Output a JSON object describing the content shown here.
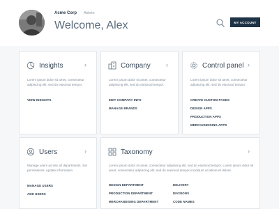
{
  "header": {
    "company": "Acme Corp",
    "role": "Admin",
    "welcome": "Welcome, Alex",
    "account_button": "MY ACCOUNT"
  },
  "cards": {
    "insights": {
      "title": "Insights",
      "desc": "Lorem ipsum dolor sit amet, consectetur adipiscing elit, sed do eiusmod tempor.",
      "links": [
        "VIEW INSIGHTS"
      ]
    },
    "company": {
      "title": "Company",
      "desc": "Lorem ipsum dolor sit amet, consectetur adipiscing elit, sed do eiusmod tempor.",
      "links": [
        "EDIT COMPANY INFO",
        "MANAGE BRANDS"
      ]
    },
    "control_panel": {
      "title": "Control panel",
      "desc": "Lorem ipsum dolor sit amet, consectetur adipiscing elit, sed do eiusmod tempor.",
      "links": [
        "CREATE CUSTOM PAGES",
        "DESIGN APPS",
        "PRODUCTION APPS",
        "MERCHANDISING APPS"
      ]
    },
    "users": {
      "title": "Users",
      "desc": "Manage users across all departments. Set permissions, update information.",
      "links": [
        "MANAGE USERS",
        "ADD USERS"
      ]
    },
    "taxonomy": {
      "title": "Taxonomy",
      "desc": "Lorem ipsum dolor sit amet, consectetur adipiscing elit, sed do eiusmod tempor. Lorem ipsum dolor sit amet, consectetur adipiscing elit, sed do eiusmod tempor incididunt ut labore et dolore.",
      "links": [
        "DESIGN DEPARTMENT",
        "PRODUCTION DEPARTMENT",
        "MERCHANDISING DEPARTMENT",
        "DELIVERY",
        "DIVISIONS",
        "CODE NAMES"
      ]
    }
  },
  "icons": {
    "search": "search-icon",
    "insights": "pie-chart-icon",
    "company": "building-icon",
    "control_panel": "gear-icon",
    "users": "users-icon",
    "taxonomy": "grid-icon",
    "chevron": "chevron-right-icon"
  },
  "colors": {
    "primary": "#1e3345",
    "background": "#f6f7f9",
    "card": "#ffffff",
    "muted_text": "#7d8a97"
  }
}
